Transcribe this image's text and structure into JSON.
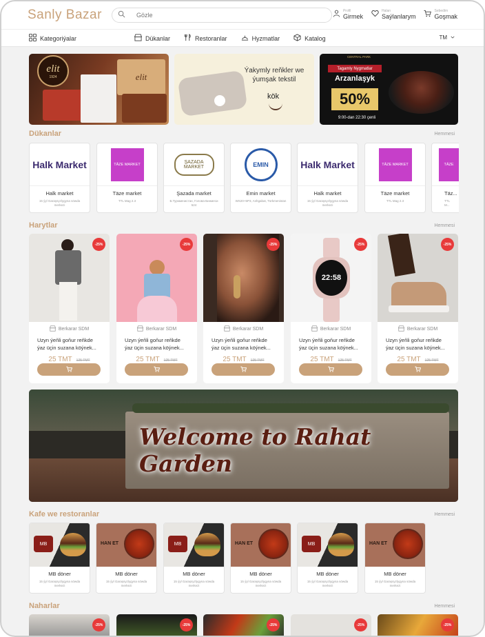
{
  "header": {
    "logo": "Sanly Bazar",
    "search_placeholder": "Gözle",
    "profile_small": "Profil",
    "profile_label": "Girmek",
    "saved_small": "Halan",
    "saved_label": "Saýlanlarym",
    "cart_small": "Sebedim",
    "cart_label": "Goşmak"
  },
  "nav": {
    "categories": "Kategoriýalar",
    "items": [
      "Dükanlar",
      "Restoranlar",
      "Hyzmatlar",
      "Katalog"
    ],
    "lang": "TM"
  },
  "banners": {
    "b1_brand": "elit",
    "b1_year": "1924",
    "b1_box": "elit",
    "b2_text": "Ýakymly reňkler we ýumşak tekstil",
    "b2_brand": "kök",
    "b3_brand": "CENTRAL PARK",
    "b3_line1": "Tagamly Nygmatlar",
    "b3_line2": "Arzanlaşyk",
    "b3_percent": "50%",
    "b3_hours": "9:00-dan 22:30 çenli"
  },
  "sections": {
    "stores": "Dükanlar",
    "products": "Harytlar",
    "cafes": "Kafe we restoranlar",
    "meals": "Naharlar",
    "more": "Hemmesi"
  },
  "stores": [
    {
      "logo": "Halk Market",
      "name": "Halk market",
      "addr": "15 ýyl Garaşsyzlygyna söwda merkezi"
    },
    {
      "logo": "TÄZE MARKET",
      "name": "Täze market",
      "addr": "TTL Mag 2.3"
    },
    {
      "logo": "ŞAZADA MARKET",
      "name": "Şazada market",
      "addr": "Б.Туркменистан, Голова-Бинмеси 524"
    },
    {
      "logo": "EMIN",
      "name": "Emin market",
      "addr": "WS20+5P3, Ashgabat, Türkmenistan"
    },
    {
      "logo": "Halk Market",
      "name": "Halk market",
      "addr": "15 ýyl Garaşsyzlygyna söwda merkezi"
    },
    {
      "logo": "TÄZE MARKET",
      "name": "Täze market",
      "addr": "TTL Mag 2.3"
    },
    {
      "logo": "TÄZE",
      "name": "Täz...",
      "addr": "TTL M..."
    }
  ],
  "products": [
    {
      "discount": "-25%",
      "shop": "Berkarar SDM",
      "title": "Uzyn ýeňli goňur reňkde ýaz üçin suzana köýnek...",
      "price": "25 TMT",
      "old": "125 TMT"
    },
    {
      "discount": "-25%",
      "shop": "Berkarar SDM",
      "title": "Uzyn ýeňli goňur reňkde ýaz üçin suzana köýnek...",
      "price": "25 TMT",
      "old": "125 TMT"
    },
    {
      "discount": "-25%",
      "shop": "Berkarar SDM",
      "title": "Uzyn ýeňli goňur reňkde ýaz üçin suzana köýnek...",
      "price": "25 TMT",
      "old": "125 TMT"
    },
    {
      "discount": "-25%",
      "shop": "Berkarar SDM",
      "title": "Uzyn ýeňli goňur reňkde ýaz üçin suzana köýnek...",
      "price": "25 TMT",
      "old": "125 TMT",
      "watch_time": "22:58"
    },
    {
      "discount": "-25%",
      "shop": "Berkarar SDM",
      "title": "Uzyn ýeňli goňur reňkde ýaz üçin suzana köýnek...",
      "price": "25 TMT",
      "old": "125 TMT"
    }
  ],
  "big_banner_text": "Welcome to Rahat Garden",
  "restaurants": [
    {
      "logo": "MB",
      "name": "MB döner",
      "addr": "15 ýyl Garaşsyzlygyna söwda merkezi"
    },
    {
      "logo": "HAN ET",
      "name": "MB döner",
      "addr": "15 ýyl Garaşsyzlygyna söwda merkezi"
    },
    {
      "logo": "MB",
      "name": "MB döner",
      "addr": "15 ýyl Garaşsyzlygyna söwda merkezi"
    },
    {
      "logo": "HAN ET",
      "name": "MB döner",
      "addr": "15 ýyl Garaşsyzlygyna söwda merkezi"
    },
    {
      "logo": "MB",
      "name": "MB döner",
      "addr": "15 ýyl Garaşsyzlygyna söwda merkezi"
    },
    {
      "logo": "HAN ET",
      "name": "MB döner",
      "addr": "15 ýyl Garaşsyzlygyna söwda merkezi"
    }
  ],
  "meals": [
    {
      "discount": "-25%"
    },
    {
      "discount": "-25%"
    },
    {
      "discount": "-25%"
    },
    {
      "discount": "-25%"
    },
    {
      "discount": "-25%"
    }
  ],
  "colors": {
    "accent": "#c9a27a",
    "discount": "#e83a3a",
    "bg": "#f2f2f2"
  }
}
